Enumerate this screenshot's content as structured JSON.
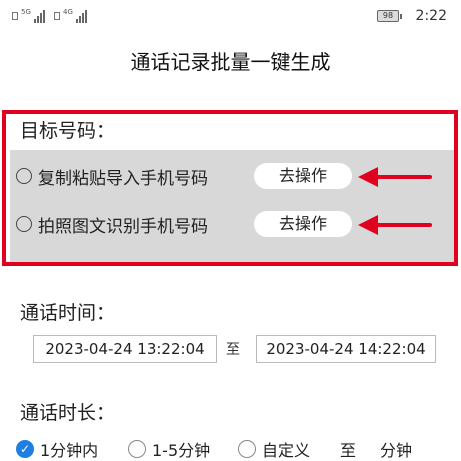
{
  "status_bar": {
    "sim1_label": "5G",
    "sim2_label": "4G",
    "battery": "98",
    "time": "2:22"
  },
  "page_title": "通话记录批量一键生成",
  "target": {
    "label": "目标号码：",
    "options": [
      {
        "label": "复制粘贴导入手机号码",
        "button": "去操作"
      },
      {
        "label": "拍照图文识别手机号码",
        "button": "去操作"
      }
    ],
    "arrow_color": "#e00020"
  },
  "call_time": {
    "label": "通话时间：",
    "start": "2023-04-24 13:22:04",
    "separator": "至",
    "end": "2023-04-24 14:22:04"
  },
  "duration": {
    "label": "通话时长：",
    "options": [
      "1分钟内",
      "1-5分钟",
      "自定义"
    ],
    "selected_index": 0,
    "custom_sep": "至",
    "custom_unit": "分钟",
    "accent_color": "#1e7fe0"
  }
}
